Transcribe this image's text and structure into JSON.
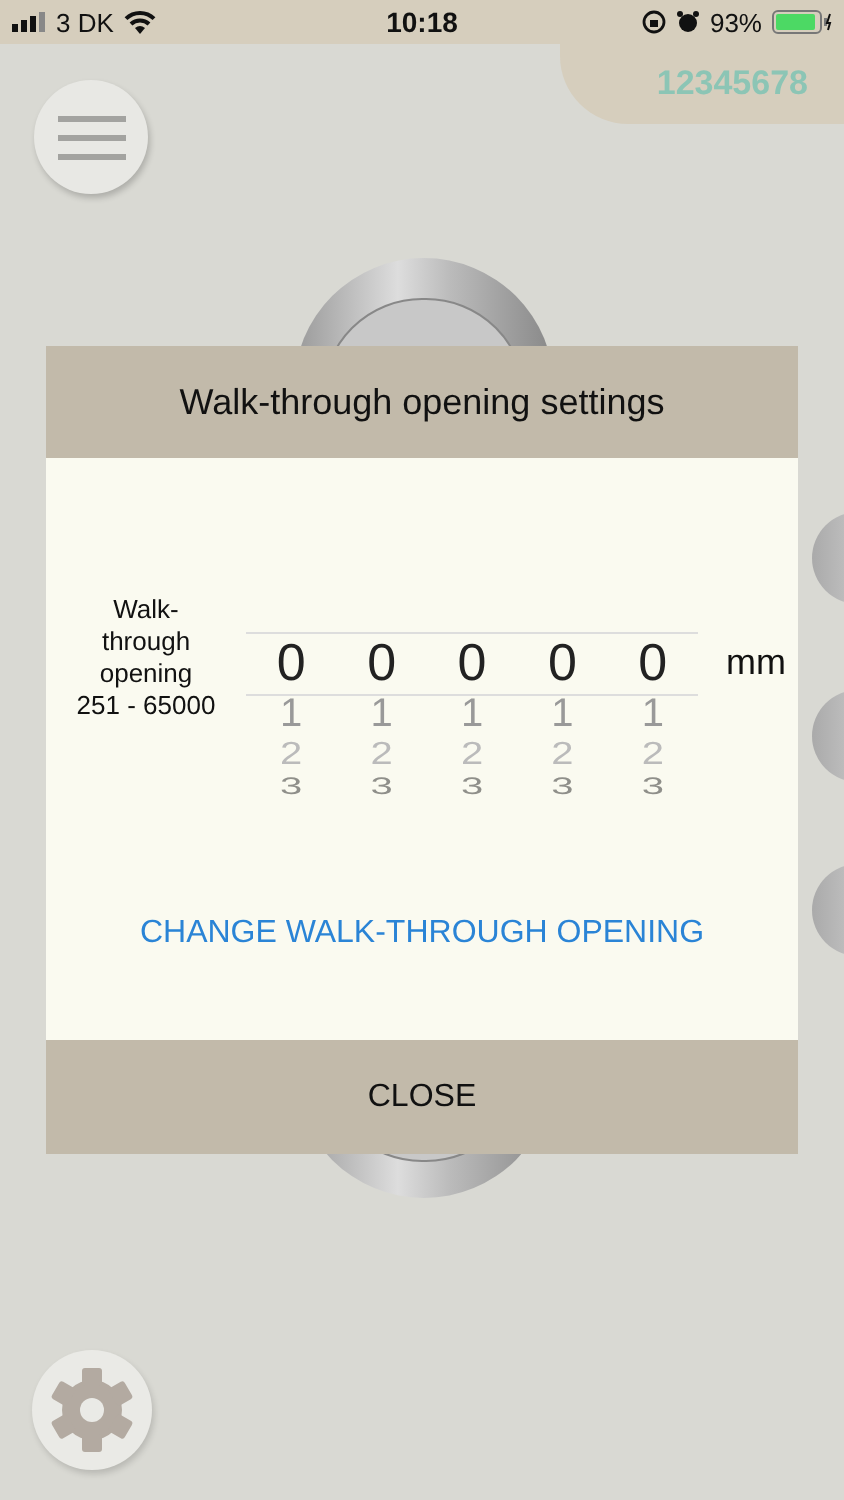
{
  "status_bar": {
    "carrier": "3 DK",
    "time": "10:18",
    "battery": "93%"
  },
  "device_id": "12345678",
  "dialog": {
    "title": "Walk-through opening settings",
    "field_label": "Walk-through opening",
    "range": "251 - 65000",
    "wheels": [
      {
        "value": "0",
        "below": [
          "1",
          "2",
          "3"
        ]
      },
      {
        "value": "0",
        "below": [
          "1",
          "2",
          "3"
        ]
      },
      {
        "value": "0",
        "below": [
          "1",
          "2",
          "3"
        ]
      },
      {
        "value": "0",
        "below": [
          "1",
          "2",
          "3"
        ]
      },
      {
        "value": "0",
        "below": [
          "1",
          "2",
          "3"
        ]
      }
    ],
    "unit": "mm",
    "action": "CHANGE WALK-THROUGH OPENING",
    "close": "CLOSE"
  }
}
